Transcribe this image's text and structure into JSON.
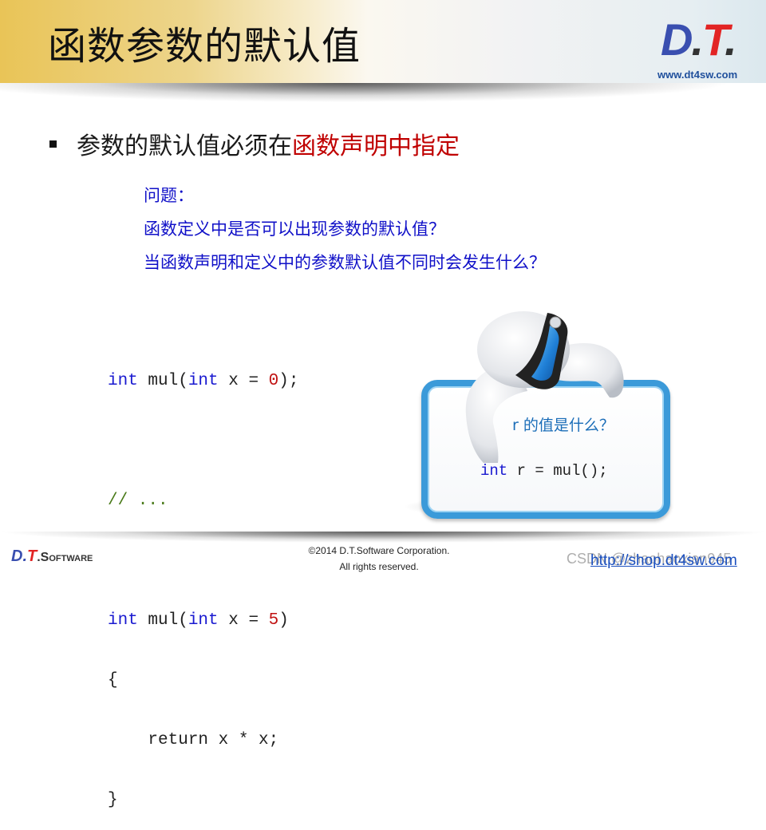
{
  "header": {
    "title": "函数参数的默认值",
    "logo": {
      "d": "D",
      "dot1": ".",
      "t": "T",
      "dot2": "."
    },
    "logo_url": "www.dt4sw.com"
  },
  "bullet": {
    "text_normal": "参数的默认值必须在",
    "text_highlight": "函数声明中指定",
    "highlight_color": "#c00000"
  },
  "questions": [
    "问题：",
    "函数定义中是否可以出现参数的默认值？",
    "当函数声明和定义中的参数默认值不同时会发生什么？"
  ],
  "code": {
    "line1": {
      "kw1": "int",
      "t1": " mul(",
      "kw2": "int",
      "t2": " x = ",
      "num": "0",
      "t3": ");"
    },
    "line2": {
      "comment": "// ..."
    },
    "line3": {
      "kw1": "int",
      "t1": " mul(",
      "kw2": "int",
      "t2": " x = ",
      "num": "5",
      "t3": ")"
    },
    "line4": "{",
    "line5": "    return x * x;",
    "line6": "}"
  },
  "card": {
    "question": "r 的值是什么？",
    "code_kw": "int",
    "code_rest": " r = mul();"
  },
  "footer": {
    "logo": {
      "d": "D",
      "t": "T",
      "sw": ".Software"
    },
    "copyright_line1": "©2014 D.T.Software Corporation.",
    "copyright_line2": "All rights reserved.",
    "link": "http://shop.dt4sw.com",
    "watermark": "CSDN @zhaohaoxian945"
  }
}
